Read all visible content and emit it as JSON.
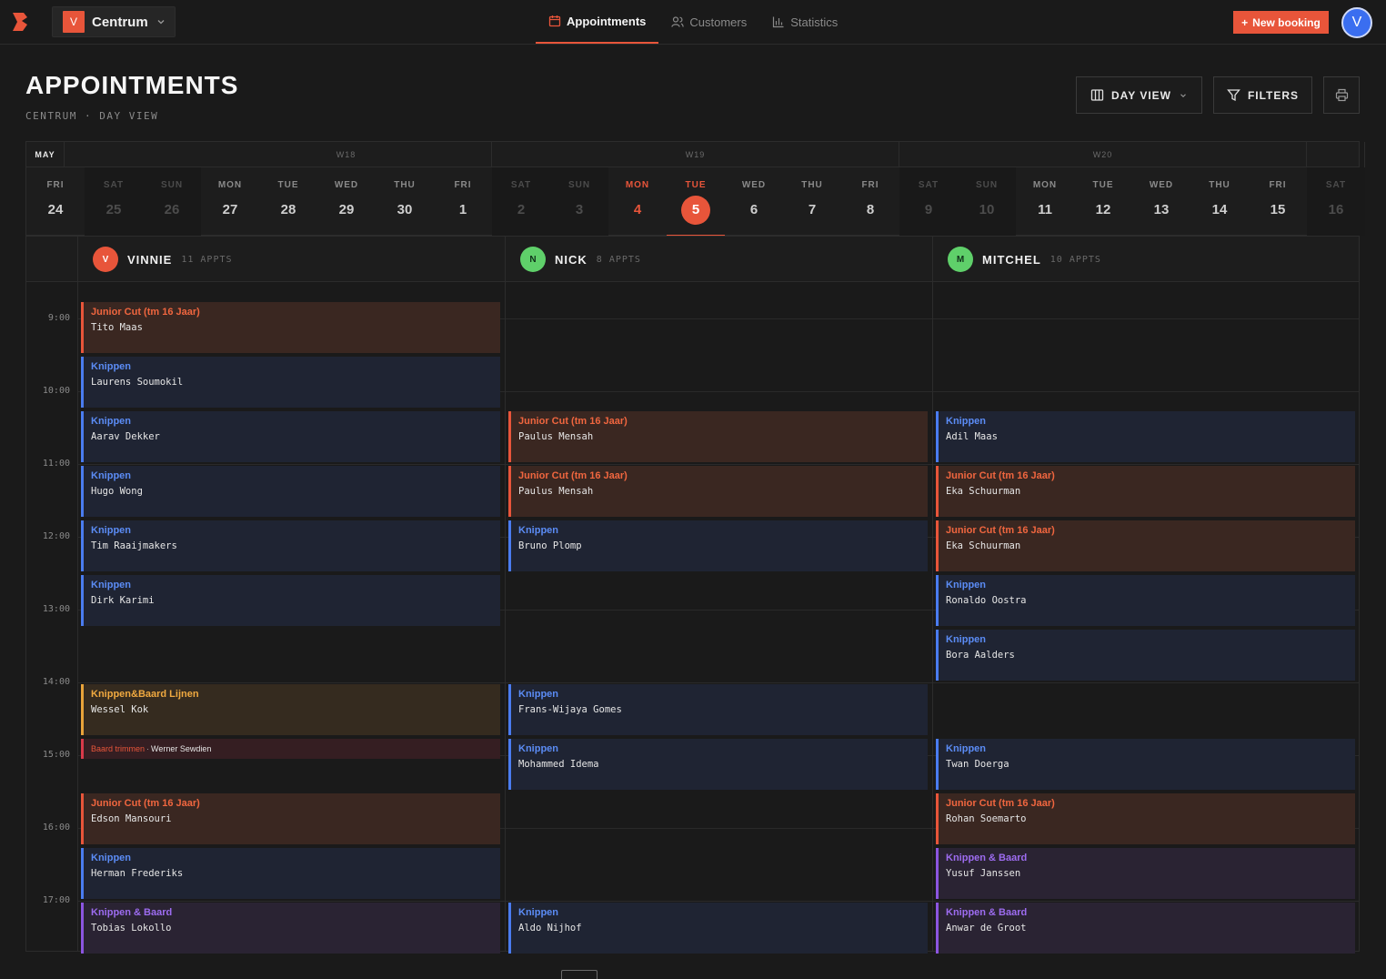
{
  "app": {
    "location_badge": "V",
    "location_name": "Centrum",
    "user_initial": "V"
  },
  "nav": [
    {
      "label": "Appointments",
      "active": true
    },
    {
      "label": "Customers",
      "active": false
    },
    {
      "label": "Statistics",
      "active": false
    }
  ],
  "new_booking": "New booking",
  "header": {
    "title": "APPOINTMENTS",
    "breadcrumb": "CENTRUM · DAY VIEW",
    "day_view": "DAY VIEW",
    "filters": "FILTERS"
  },
  "weeks": [
    {
      "label": "MAY",
      "month": true
    },
    {
      "label": ""
    },
    {
      "label": "W18"
    },
    {
      "label": "W19"
    },
    {
      "label": "W20"
    }
  ],
  "days": [
    {
      "name": "FRI",
      "date": "24"
    },
    {
      "name": "SAT",
      "date": "25",
      "weekend": true
    },
    {
      "name": "SUN",
      "date": "26",
      "weekend": true
    },
    {
      "name": "MON",
      "date": "27"
    },
    {
      "name": "TUE",
      "date": "28"
    },
    {
      "name": "WED",
      "date": "29"
    },
    {
      "name": "THU",
      "date": "30"
    },
    {
      "name": "FRI",
      "date": "1"
    },
    {
      "name": "SAT",
      "date": "2",
      "weekend": true
    },
    {
      "name": "SUN",
      "date": "3",
      "weekend": true
    },
    {
      "name": "MON",
      "date": "4",
      "today": true
    },
    {
      "name": "TUE",
      "date": "5",
      "selected": true
    },
    {
      "name": "WED",
      "date": "6"
    },
    {
      "name": "THU",
      "date": "7"
    },
    {
      "name": "FRI",
      "date": "8"
    },
    {
      "name": "SAT",
      "date": "9",
      "weekend": true
    },
    {
      "name": "SUN",
      "date": "10",
      "weekend": true
    },
    {
      "name": "MON",
      "date": "11"
    },
    {
      "name": "TUE",
      "date": "12"
    },
    {
      "name": "WED",
      "date": "13"
    },
    {
      "name": "THU",
      "date": "14"
    },
    {
      "name": "FRI",
      "date": "15"
    },
    {
      "name": "SAT",
      "date": "16",
      "weekend": true
    }
  ],
  "hours": [
    "9:00",
    "10:00",
    "11:00",
    "12:00",
    "13:00",
    "14:00",
    "15:00",
    "16:00",
    "17:00"
  ],
  "staff": [
    {
      "initial": "V",
      "name": "VINNIE",
      "count": "11 APPTS",
      "color": "#e8553a",
      "text": "#ffffff",
      "appts": [
        {
          "service": "Junior Cut (tm 16 Jaar)",
          "customer": "Tito Maas",
          "start": 8.75,
          "cat": "orange"
        },
        {
          "service": "Knippen",
          "customer": "Laurens Soumokil",
          "start": 9.5,
          "cat": "blue"
        },
        {
          "service": "Knippen",
          "customer": "Aarav Dekker",
          "start": 10.25,
          "cat": "blue"
        },
        {
          "service": "Knippen",
          "customer": "Hugo Wong",
          "start": 11.0,
          "cat": "blue"
        },
        {
          "service": "Knippen",
          "customer": "Tim Raaijmakers",
          "start": 11.75,
          "cat": "blue"
        },
        {
          "service": "Knippen",
          "customer": "Dirk Karimi",
          "start": 12.5,
          "cat": "blue"
        },
        {
          "service": "Knippen&Baard Lijnen",
          "customer": "Wessel Kok",
          "start": 14.0,
          "cat": "gold"
        },
        {
          "service": "Baard trimmen",
          "customer": "Werner Sewdien",
          "start": 14.75,
          "cat": "red",
          "small": true
        },
        {
          "service": "Junior Cut (tm 16 Jaar)",
          "customer": "Edson Mansouri",
          "start": 15.5,
          "cat": "orange"
        },
        {
          "service": "Knippen",
          "customer": "Herman Frederiks",
          "start": 16.25,
          "cat": "blue"
        },
        {
          "service": "Knippen & Baard",
          "customer": "Tobias Lokollo",
          "start": 17.0,
          "cat": "purple"
        }
      ]
    },
    {
      "initial": "N",
      "name": "NICK",
      "count": "8 APPTS",
      "color": "#5fd06a",
      "text": "#10301a",
      "appts": [
        {
          "service": "Junior Cut (tm 16 Jaar)",
          "customer": "Paulus Mensah",
          "start": 10.25,
          "cat": "orange"
        },
        {
          "service": "Junior Cut (tm 16 Jaar)",
          "customer": "Paulus Mensah",
          "start": 11.0,
          "cat": "orange"
        },
        {
          "service": "Knippen",
          "customer": "Bruno Plomp",
          "start": 11.75,
          "cat": "blue"
        },
        {
          "service": "Knippen",
          "customer": "Frans-Wijaya Gomes",
          "start": 14.0,
          "cat": "blue"
        },
        {
          "service": "Knippen",
          "customer": "Mohammed Idema",
          "start": 14.75,
          "cat": "blue"
        },
        {
          "service": "Knippen",
          "customer": "Aldo Nijhof",
          "start": 17.0,
          "cat": "blue"
        }
      ]
    },
    {
      "initial": "M",
      "name": "MITCHEL",
      "count": "10 APPTS",
      "color": "#5fd06a",
      "text": "#10301a",
      "appts": [
        {
          "service": "Knippen",
          "customer": "Adil Maas",
          "start": 10.25,
          "cat": "blue"
        },
        {
          "service": "Junior Cut (tm 16 Jaar)",
          "customer": "Eka Schuurman",
          "start": 11.0,
          "cat": "orange"
        },
        {
          "service": "Junior Cut (tm 16 Jaar)",
          "customer": "Eka Schuurman",
          "start": 11.75,
          "cat": "orange"
        },
        {
          "service": "Knippen",
          "customer": "Ronaldo Oostra",
          "start": 12.5,
          "cat": "blue"
        },
        {
          "service": "Knippen",
          "customer": "Bora Aalders",
          "start": 13.25,
          "cat": "blue"
        },
        {
          "service": "Knippen",
          "customer": "Twan Doerga",
          "start": 14.75,
          "cat": "blue"
        },
        {
          "service": "Junior Cut (tm 16 Jaar)",
          "customer": "Rohan Soemarto",
          "start": 15.5,
          "cat": "orange"
        },
        {
          "service": "Knippen & Baard",
          "customer": "Yusuf Janssen",
          "start": 16.25,
          "cat": "purple"
        },
        {
          "service": "Knippen & Baard",
          "customer": "Anwar de Groot",
          "start": 17.0,
          "cat": "purple"
        }
      ]
    }
  ],
  "colors": {
    "accent": "#e8553a",
    "blue": "#4a7cf0",
    "gold": "#e8a33a",
    "purple": "#8c55e0",
    "red": "#d83a4a"
  }
}
